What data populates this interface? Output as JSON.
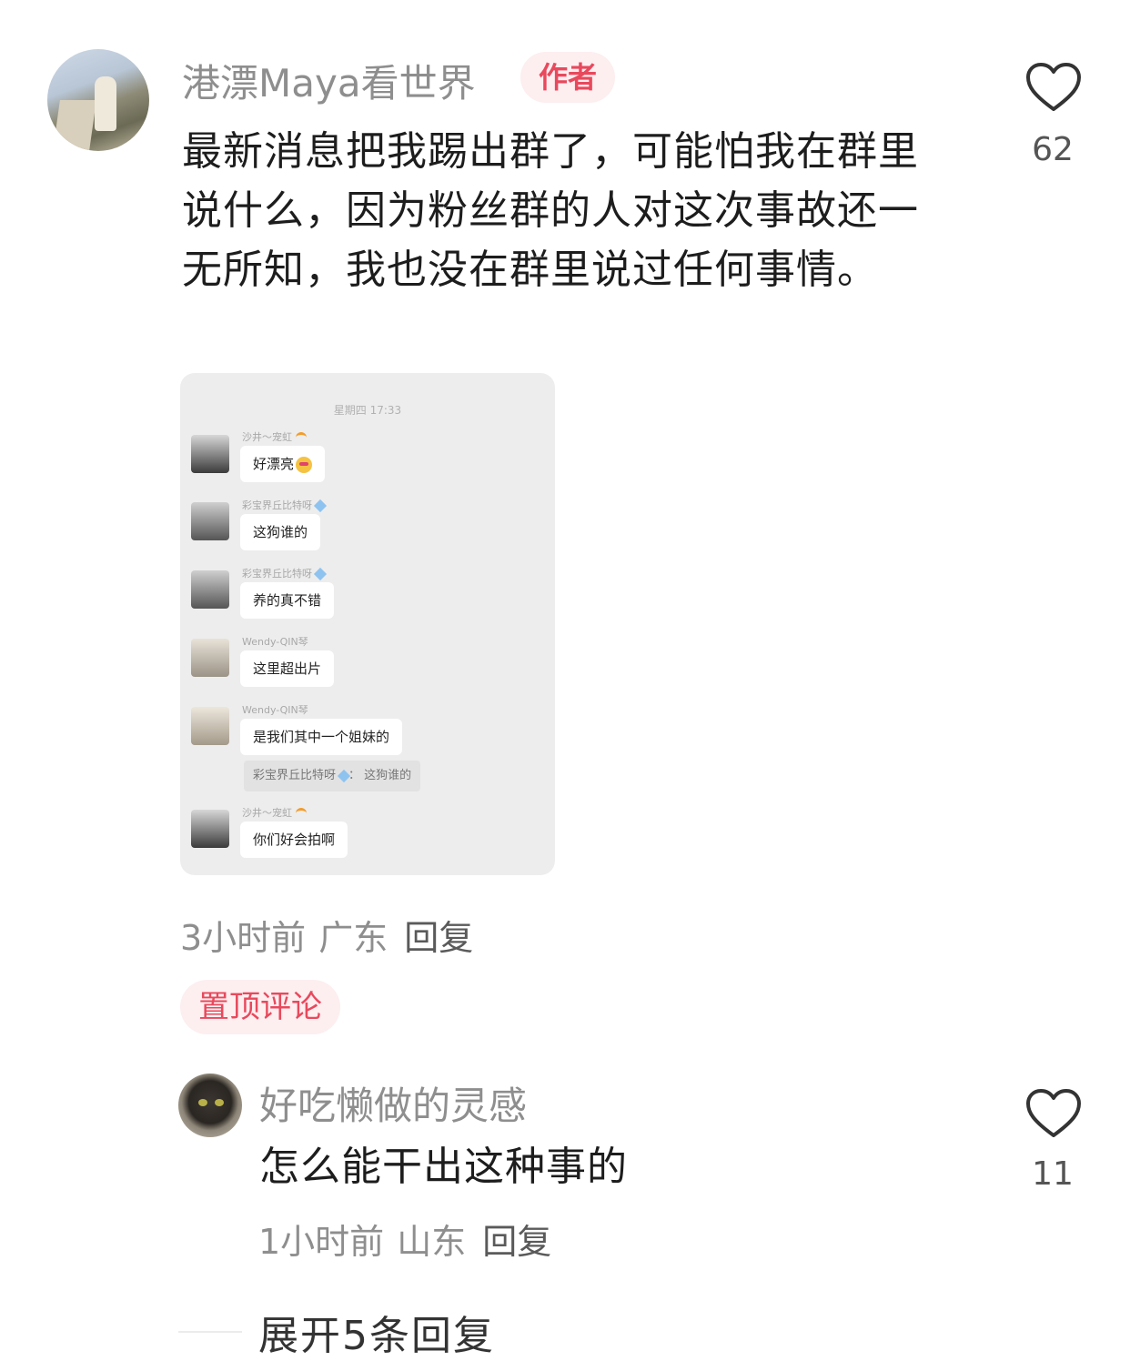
{
  "main_comment": {
    "username": "港漂Maya看世界",
    "author_badge": "作者",
    "text": "最新消息把我踢出群了，可能怕我在群里说什么，因为粉丝群的人对这次事故还一无所知，我也没在群里说过任何事情。",
    "like_count": "62",
    "time": "3小时前",
    "location": "广东",
    "reply_label": "回复"
  },
  "chat_screenshot": {
    "timestamp": "星期四 17:33",
    "messages": [
      {
        "sender": "沙井～宠虹",
        "text": "好漂亮"
      },
      {
        "sender": "彩宝界丘比特呀",
        "text": "这狗谁的"
      },
      {
        "sender": "彩宝界丘比特呀",
        "text": "养的真不错"
      },
      {
        "sender": "Wendy-QIN琴",
        "text": "这里超出片"
      },
      {
        "sender": "Wendy-QIN琴",
        "text": "是我们其中一个姐妹的",
        "quote_sender": "彩宝界丘比特呀",
        "quote_text": "这狗谁的"
      },
      {
        "sender": "沙井～宠虹",
        "text": "你们好会拍啊"
      }
    ]
  },
  "pinned_label": "置顶评论",
  "reply_comment": {
    "username": "好吃懒做的灵感",
    "text": "怎么能干出这种事的",
    "like_count": "11",
    "time": "1小时前",
    "location": "山东",
    "reply_label": "回复"
  },
  "expand_replies": "展开5条回复",
  "colors": {
    "accent": "#e8495c",
    "badge_bg": "#fdeef0",
    "meta_gray": "#8e8e8e"
  }
}
